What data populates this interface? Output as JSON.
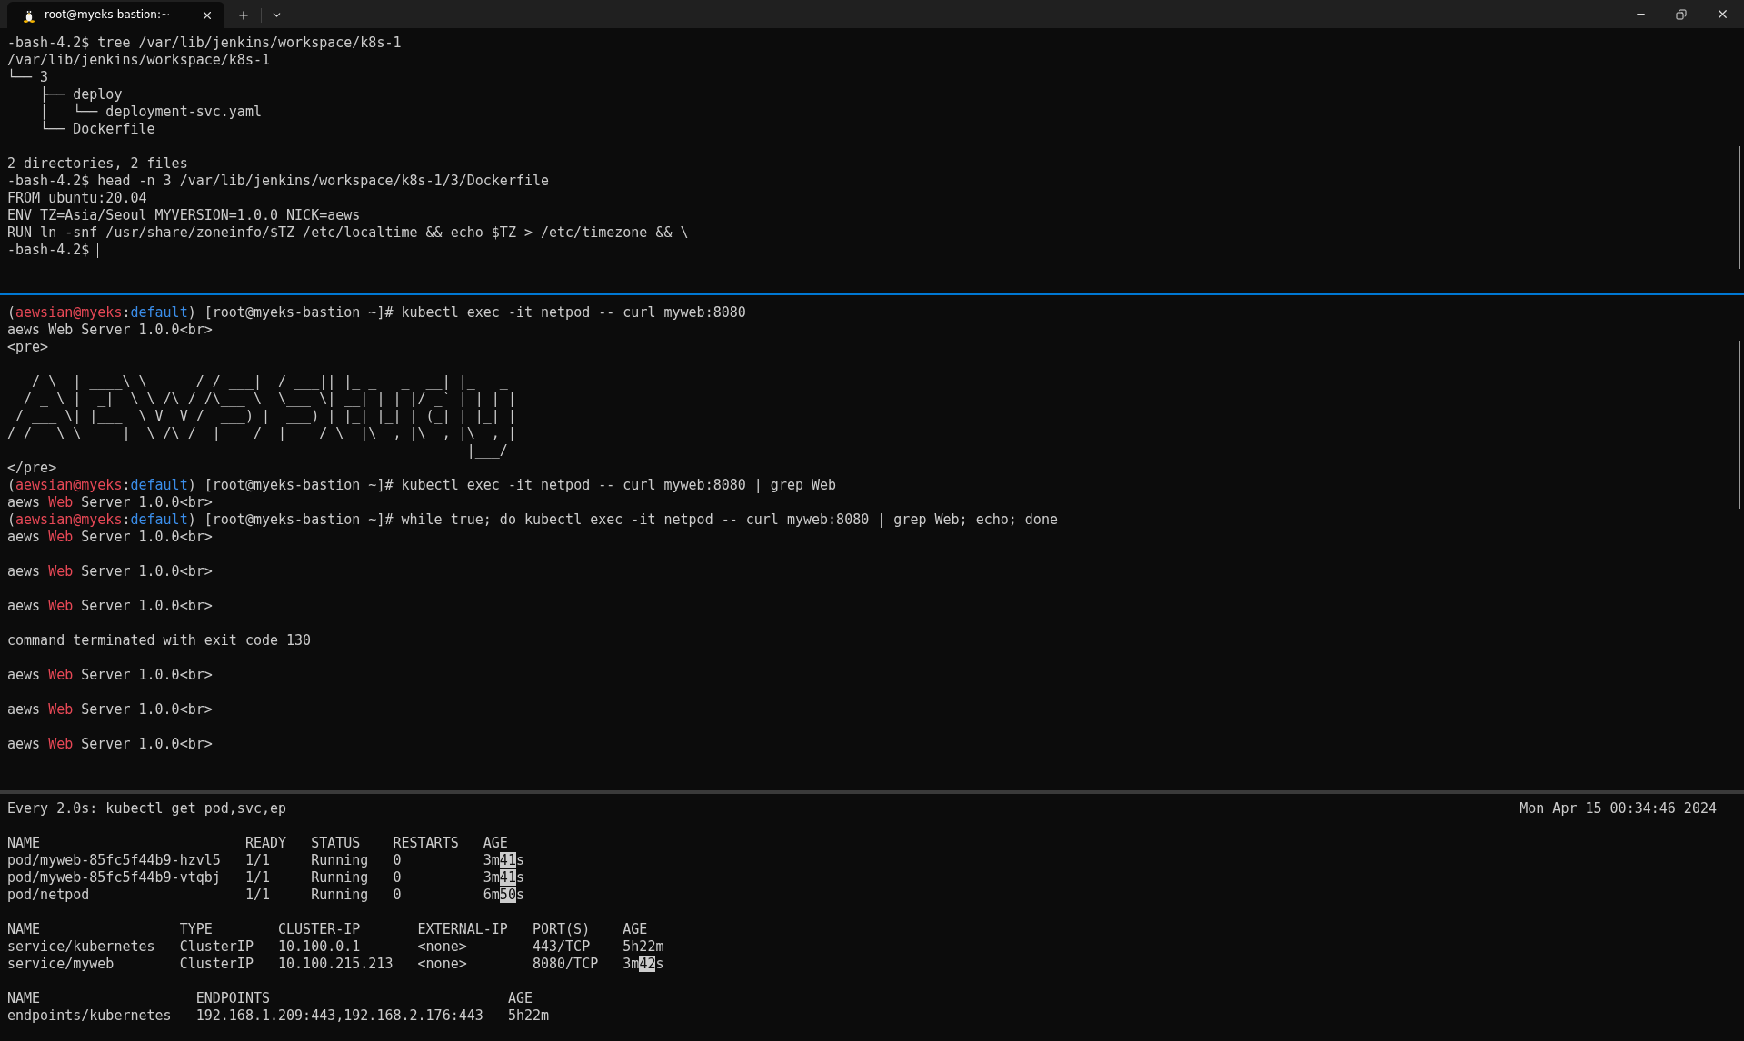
{
  "tab": {
    "title": "root@myeks-bastion:~",
    "selected": true
  },
  "panes": [
    {
      "lines": [
        {
          "kind": "text",
          "text": "-bash-4.2$ tree /var/lib/jenkins/workspace/k8s-1"
        },
        {
          "kind": "text",
          "text": "/var/lib/jenkins/workspace/k8s-1"
        },
        {
          "kind": "text",
          "text": "└── 3"
        },
        {
          "kind": "text",
          "text": "    ├── deploy"
        },
        {
          "kind": "text",
          "text": "    │   └── deployment-svc.yaml"
        },
        {
          "kind": "text",
          "text": "    └── Dockerfile"
        },
        {
          "kind": "blank"
        },
        {
          "kind": "text",
          "text": "2 directories, 2 files"
        },
        {
          "kind": "text",
          "text": "-bash-4.2$ head -n 3 /var/lib/jenkins/workspace/k8s-1/3/Dockerfile"
        },
        {
          "kind": "text",
          "text": "FROM ubuntu:20.04"
        },
        {
          "kind": "text",
          "text": "ENV TZ=Asia/Seoul MYVERSION=1.0.0 NICK=aews"
        },
        {
          "kind": "text",
          "text": "RUN ln -snf /usr/share/zoneinfo/$TZ /etc/localtime && echo $TZ > /etc/timezone && \\"
        },
        {
          "kind": "cursor",
          "text": "-bash-4.2$ "
        }
      ]
    },
    {
      "lines": [
        {
          "kind": "mixed",
          "segments": [
            {
              "text": "(",
              "kind": "plain"
            },
            {
              "text": "aewsian@myeks",
              "kind": "red"
            },
            {
              "text": ":",
              "kind": "plain"
            },
            {
              "text": "default",
              "kind": "blue"
            },
            {
              "text": ") [root@myeks-bastion ~]# kubectl exec -it netpod -- curl myweb:8080",
              "kind": "plain"
            }
          ]
        },
        {
          "kind": "text",
          "text": "aews Web Server 1.0.0<br>"
        },
        {
          "kind": "text",
          "text": "<pre>"
        },
        {
          "kind": "text",
          "text": "    _    _______        ______    ____  _             _"
        },
        {
          "kind": "text",
          "text": "   / \\  | ____\\ \\      / / ___|  / ___|| |_ _   _  __| |_   _"
        },
        {
          "kind": "text",
          "text": "  / _ \\ |  _|  \\ \\ /\\ / /\\___ \\  \\___ \\| __| | | |/ _` | | | |"
        },
        {
          "kind": "text",
          "text": " / ___ \\| |___  \\ V  V /  ___) |  ___) | |_| |_| | (_| | |_| |"
        },
        {
          "kind": "text",
          "text": "/_/   \\_\\_____|  \\_/\\_/  |____/  |____/ \\__|\\__,_|\\__,_|\\__, |"
        },
        {
          "kind": "text",
          "text": "                                                        |___/"
        },
        {
          "kind": "text",
          "text": "</pre>"
        },
        {
          "kind": "mixed",
          "segments": [
            {
              "text": "(",
              "kind": "plain"
            },
            {
              "text": "aewsian@myeks",
              "kind": "red"
            },
            {
              "text": ":",
              "kind": "plain"
            },
            {
              "text": "default",
              "kind": "blue"
            },
            {
              "text": ") [root@myeks-bastion ~]# kubectl exec -it netpod -- curl myweb:8080 | grep Web",
              "kind": "plain"
            }
          ]
        },
        {
          "kind": "mixed",
          "segments": [
            {
              "text": "aews ",
              "kind": "plain"
            },
            {
              "text": "Web",
              "kind": "red"
            },
            {
              "text": " Server 1.0.0<br>",
              "kind": "plain"
            }
          ]
        },
        {
          "kind": "mixed",
          "segments": [
            {
              "text": "(",
              "kind": "plain"
            },
            {
              "text": "aewsian@myeks",
              "kind": "red"
            },
            {
              "text": ":",
              "kind": "plain"
            },
            {
              "text": "default",
              "kind": "blue"
            },
            {
              "text": ") [root@myeks-bastion ~]# while true; do kubectl exec -it netpod -- curl myweb:8080 | grep Web; echo; done",
              "kind": "plain"
            }
          ]
        },
        {
          "kind": "mixed",
          "segments": [
            {
              "text": "aews ",
              "kind": "plain"
            },
            {
              "text": "Web",
              "kind": "red"
            },
            {
              "text": " Server 1.0.0<br>",
              "kind": "plain"
            }
          ]
        },
        {
          "kind": "blank"
        },
        {
          "kind": "mixed",
          "segments": [
            {
              "text": "aews ",
              "kind": "plain"
            },
            {
              "text": "Web",
              "kind": "red"
            },
            {
              "text": " Server 1.0.0<br>",
              "kind": "plain"
            }
          ]
        },
        {
          "kind": "blank"
        },
        {
          "kind": "mixed",
          "segments": [
            {
              "text": "aews ",
              "kind": "plain"
            },
            {
              "text": "Web",
              "kind": "red"
            },
            {
              "text": " Server 1.0.0<br>",
              "kind": "plain"
            }
          ]
        },
        {
          "kind": "blank"
        },
        {
          "kind": "text",
          "text": "command terminated with exit code 130"
        },
        {
          "kind": "blank"
        },
        {
          "kind": "mixed",
          "segments": [
            {
              "text": "aews ",
              "kind": "plain"
            },
            {
              "text": "Web",
              "kind": "red"
            },
            {
              "text": " Server 1.0.0<br>",
              "kind": "plain"
            }
          ]
        },
        {
          "kind": "blank"
        },
        {
          "kind": "mixed",
          "segments": [
            {
              "text": "aews ",
              "kind": "plain"
            },
            {
              "text": "Web",
              "kind": "red"
            },
            {
              "text": " Server 1.0.0<br>",
              "kind": "plain"
            }
          ]
        },
        {
          "kind": "blank"
        },
        {
          "kind": "mixed",
          "segments": [
            {
              "text": "aews ",
              "kind": "plain"
            },
            {
              "text": "Web",
              "kind": "red"
            },
            {
              "text": " Server 1.0.0<br>",
              "kind": "plain"
            }
          ]
        }
      ]
    },
    {
      "header": {
        "command": "Every 2.0s: kubectl get pod,svc,ep",
        "time": "Mon Apr 15 00:34:46 2024"
      },
      "lines": [
        {
          "kind": "blank"
        },
        {
          "kind": "text",
          "text": "NAME                         READY   STATUS    RESTARTS   AGE"
        },
        {
          "kind": "mixed",
          "segments": [
            {
              "text": "pod/myweb-85fc5f44b9-hzvl5   1/1     Running   0          3m",
              "kind": "plain"
            },
            {
              "text": "41",
              "kind": "inverse"
            },
            {
              "text": "s",
              "kind": "plain"
            }
          ]
        },
        {
          "kind": "mixed",
          "segments": [
            {
              "text": "pod/myweb-85fc5f44b9-vtqbj   1/1     Running   0          3m",
              "kind": "plain"
            },
            {
              "text": "41",
              "kind": "inverse"
            },
            {
              "text": "s",
              "kind": "plain"
            }
          ]
        },
        {
          "kind": "mixed",
          "segments": [
            {
              "text": "pod/netpod                   1/1     Running   0          6m",
              "kind": "plain"
            },
            {
              "text": "50",
              "kind": "inverse"
            },
            {
              "text": "s",
              "kind": "plain"
            }
          ]
        },
        {
          "kind": "blank"
        },
        {
          "kind": "text",
          "text": "NAME                 TYPE        CLUSTER-IP       EXTERNAL-IP   PORT(S)    AGE"
        },
        {
          "kind": "text",
          "text": "service/kubernetes   ClusterIP   10.100.0.1       <none>        443/TCP    5h22m"
        },
        {
          "kind": "mixed",
          "segments": [
            {
              "text": "service/myweb        ClusterIP   10.100.215.213   <none>        8080/TCP   3m",
              "kind": "plain"
            },
            {
              "text": "42",
              "kind": "inverse"
            },
            {
              "text": "s",
              "kind": "plain"
            }
          ]
        },
        {
          "kind": "blank"
        },
        {
          "kind": "text",
          "text": "NAME                   ENDPOINTS                             AGE"
        },
        {
          "kind": "text",
          "text": "endpoints/kubernetes   192.168.1.209:443,192.168.2.176:443   5h22m"
        }
      ]
    }
  ]
}
